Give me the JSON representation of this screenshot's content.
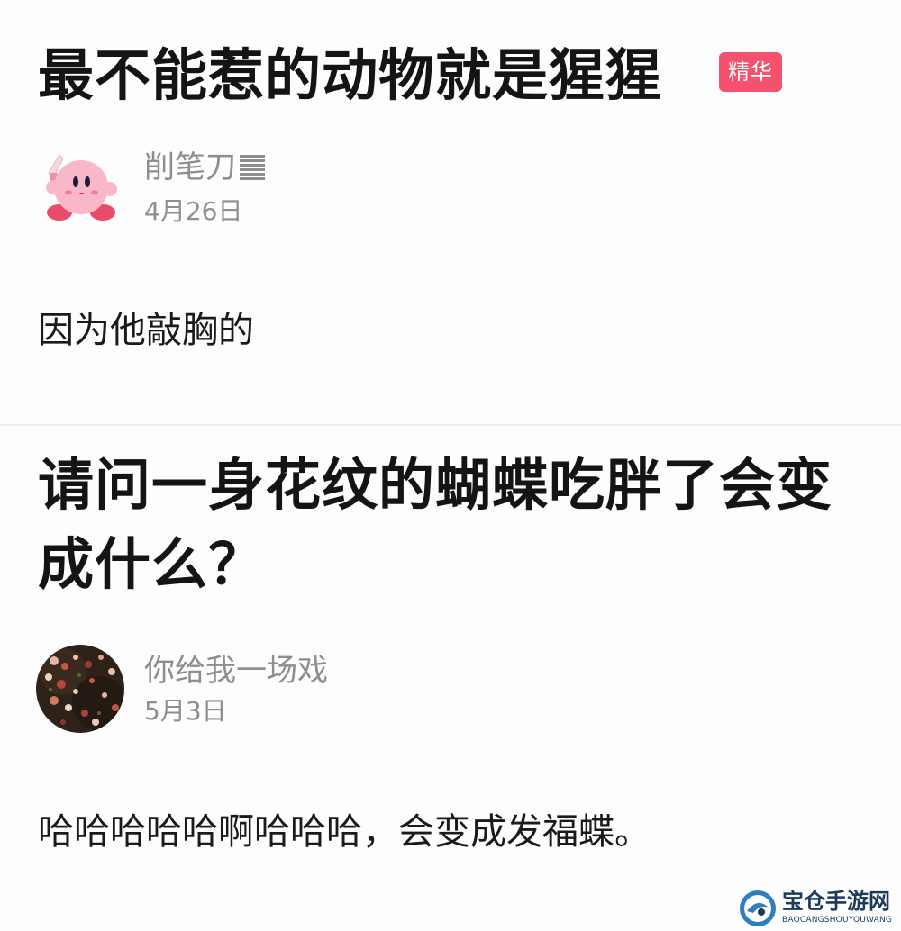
{
  "posts": [
    {
      "title": "最不能惹的动物就是猩猩",
      "badge": "精华",
      "author": "削笔刀",
      "date": "4月26日",
      "content": "因为他敲胸的"
    },
    {
      "title": "请问一身花纹的蝴蝶吃胖了会变成什么？",
      "author": "你给我一场戏",
      "date": "5月3日",
      "content": "哈哈哈哈哈啊哈哈哈，会变成发福蝶。"
    }
  ],
  "watermark": {
    "title": "宝仓手游网",
    "subtitle": "BAOCANGSHOUYOUWANG"
  },
  "colors": {
    "badge": "#f3516e",
    "muted_text": "#8e8e8e",
    "title_text": "#141414"
  },
  "icons": {
    "avatar_1": "kirby-avatar",
    "avatar_2": "floral-avatar",
    "author_1_suffix": "bars-icon"
  }
}
